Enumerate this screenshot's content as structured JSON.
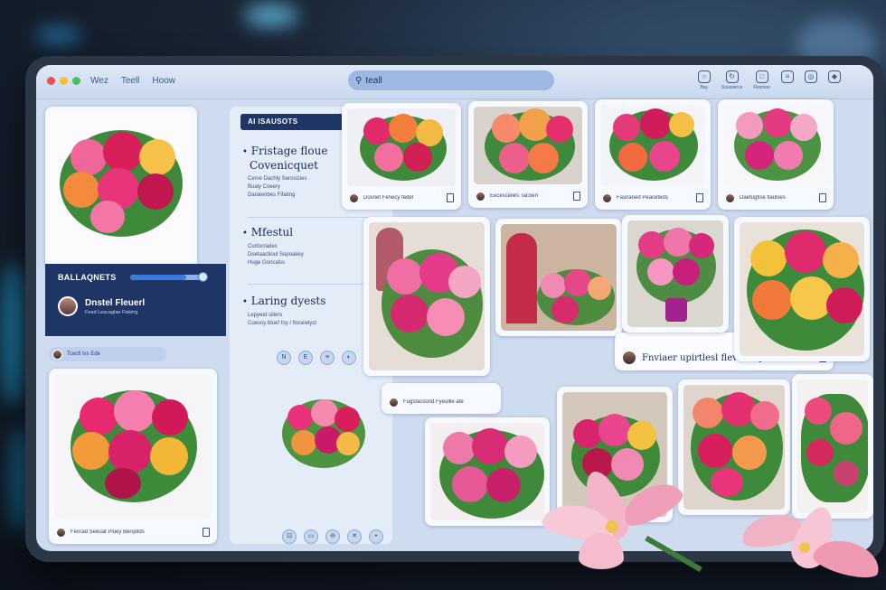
{
  "topbar": {
    "nav": [
      "Wez",
      "Teell",
      "Hoow"
    ],
    "search": {
      "value": "teall"
    },
    "tools": [
      {
        "icon": "bulb-icon",
        "label": "Bay"
      },
      {
        "icon": "share-icon",
        "label": "Sousserce"
      },
      {
        "icon": "chat-icon",
        "label": "Resmoe"
      },
      {
        "icon": "doc-icon",
        "label": ""
      },
      {
        "icon": "globe-icon",
        "label": ""
      },
      {
        "icon": "tag-icon",
        "label": ""
      }
    ]
  },
  "left": {
    "banner": {
      "title": "BALLAQNETS",
      "slider_value": 0.75,
      "user_name": "Dnstel Fleuerl",
      "user_sub": "Fead Leacaglae Fisking"
    },
    "pill_text": "Tcectl Ivs Ede",
    "card_caption": "Fenrad Seeuat Pluey Berqolds"
  },
  "middle": {
    "tag": "AI ISAUSOTS",
    "sections": [
      {
        "title_lines": [
          "Fristage floue",
          "Covenicquet"
        ],
        "items": [
          "Cerve Dachly Serosizies",
          "Bualy Coeery",
          "Daratenbes Fifating"
        ]
      },
      {
        "title_lines": [
          "Mfestul"
        ],
        "items": [
          "Curtocrades",
          "Doetaactioul Sopoakey",
          "Huge Goncalss"
        ]
      },
      {
        "title_lines": [
          "Laring dyests"
        ],
        "items": [
          "Lepyeet siliers",
          "Coesoy bluef foy / floceielyst"
        ]
      }
    ],
    "icons_top": [
      "N",
      "E",
      "≡",
      "◐",
      "•"
    ],
    "icons_bottom": [
      "⊡",
      "▭",
      "⊖",
      "✕",
      "•"
    ]
  },
  "grid": {
    "captions": [
      "Dosnet Fenecy fedel",
      "Eecesceiles Tacoen",
      "Fasnaned Peaceteds",
      "Daetugfise fiaulses",
      "",
      "",
      "Fnviaer upirtlesl flevr boquets",
      "",
      "Fugsfacsond Fyeullle afe"
    ]
  }
}
